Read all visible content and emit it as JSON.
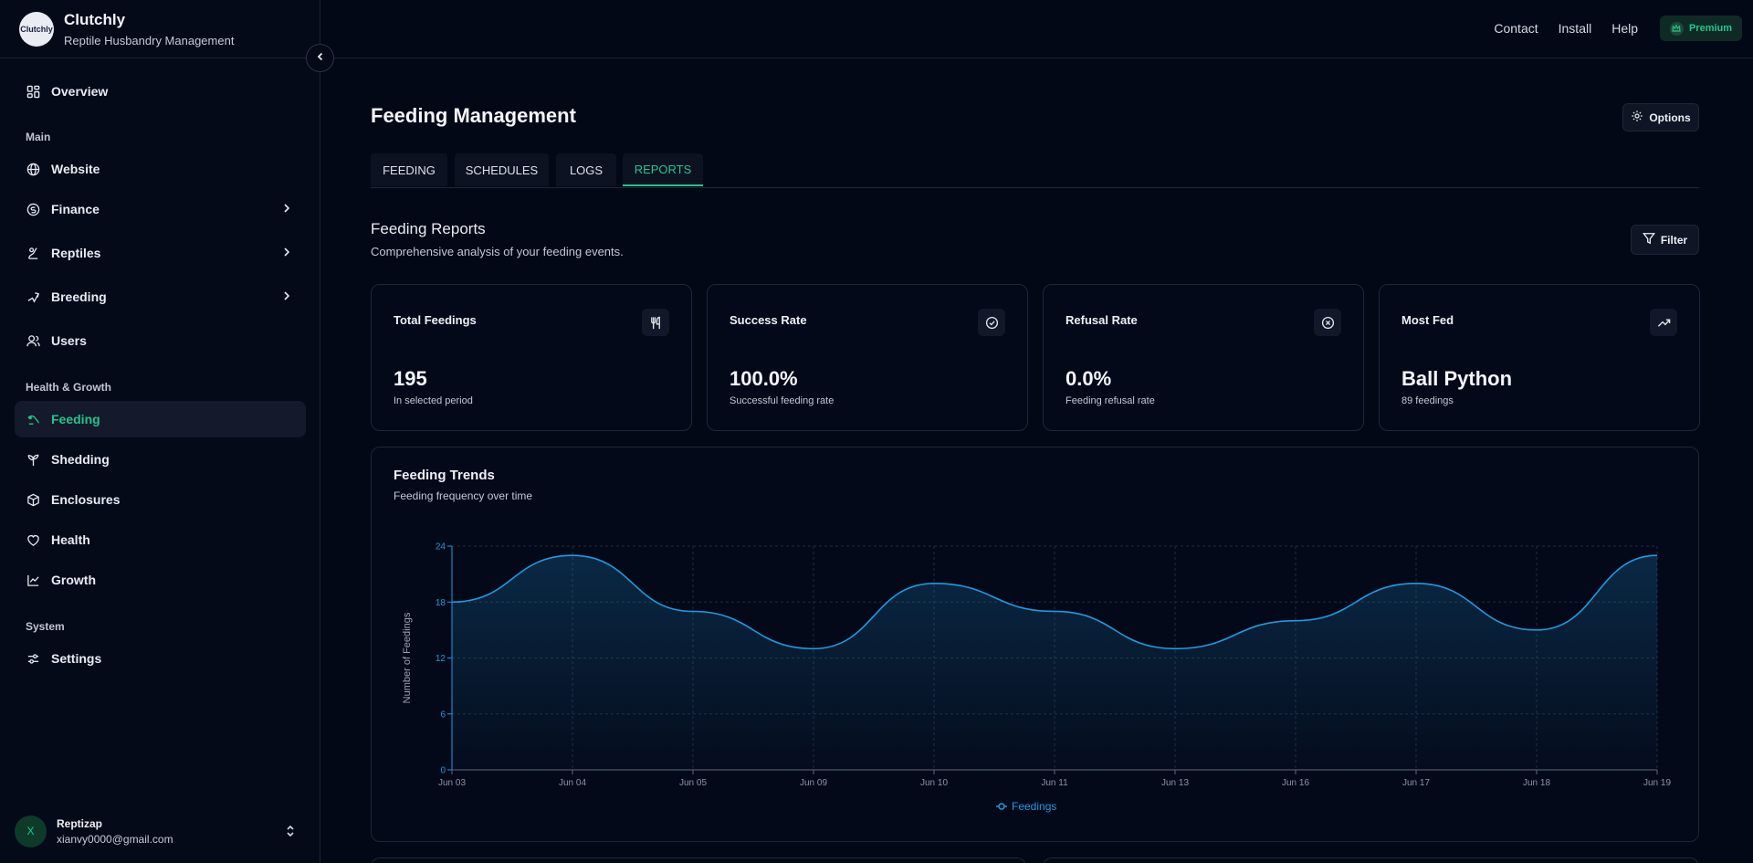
{
  "brand": {
    "logo_text": "Clutchly",
    "name": "Clutchly",
    "subtitle": "Reptile Husbandry Management"
  },
  "sidebar": {
    "overview": "Overview",
    "section_main": "Main",
    "website": "Website",
    "finance": "Finance",
    "reptiles": "Reptiles",
    "breeding": "Breeding",
    "users": "Users",
    "section_health": "Health & Growth",
    "feeding": "Feeding",
    "shedding": "Shedding",
    "enclosures": "Enclosures",
    "health": "Health",
    "growth": "Growth",
    "section_system": "System",
    "settings": "Settings"
  },
  "user": {
    "initial": "X",
    "name": "Reptizap",
    "email": "xianvy0000@gmail.com"
  },
  "topbar": {
    "contact": "Contact",
    "install": "Install",
    "help": "Help",
    "premium": "Premium"
  },
  "page": {
    "title": "Feeding Management",
    "options": "Options"
  },
  "tabs": {
    "feeding": "FEEDING",
    "schedules": "SCHEDULES",
    "logs": "LOGS",
    "reports": "REPORTS"
  },
  "reports": {
    "title": "Feeding Reports",
    "subtitle": "Comprehensive analysis of your feeding events.",
    "filter": "Filter"
  },
  "cards": {
    "total": {
      "title": "Total Feedings",
      "value": "195",
      "desc": "In selected period"
    },
    "success": {
      "title": "Success Rate",
      "value": "100.0%",
      "desc": "Successful feeding rate"
    },
    "refusal": {
      "title": "Refusal Rate",
      "value": "0.0%",
      "desc": "Feeding refusal rate"
    },
    "most": {
      "title": "Most Fed",
      "value": "Ball Python",
      "desc": "89 feedings"
    }
  },
  "trend": {
    "title": "Feeding Trends",
    "subtitle": "Feeding frequency over time"
  },
  "colors": {
    "accent": "#22c58b",
    "chart_line": "#1e9be0"
  },
  "chart_data": {
    "type": "area",
    "categories": [
      "Jun 03",
      "Jun 04",
      "Jun 05",
      "Jun 09",
      "Jun 10",
      "Jun 11",
      "Jun 13",
      "Jun 16",
      "Jun 17",
      "Jun 18",
      "Jun 19"
    ],
    "series": [
      {
        "name": "Feedings",
        "values": [
          18,
          23,
          17,
          13,
          20,
          17,
          13,
          16,
          20,
          15,
          23
        ]
      }
    ],
    "ylabel": "Number of Feedings",
    "xlabel": "",
    "ylim": [
      0,
      24
    ],
    "yticks": [
      0,
      6,
      12,
      18,
      24
    ],
    "grid": true,
    "legend": "bottom-center"
  }
}
